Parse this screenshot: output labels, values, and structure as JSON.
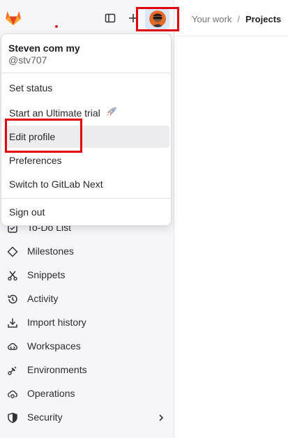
{
  "header": {
    "breadcrumb": {
      "parent": "Your work",
      "separator": "/",
      "current": "Projects"
    }
  },
  "user_menu": {
    "name": "Steven com my",
    "handle": "@stv707",
    "items": [
      {
        "label": "Set status"
      },
      {
        "label": "Start an Ultimate trial"
      },
      {
        "label": "Edit profile"
      },
      {
        "label": "Preferences"
      },
      {
        "label": "Switch to GitLab Next"
      },
      {
        "label": "Sign out"
      }
    ]
  },
  "sidebar": {
    "items": [
      {
        "label": "To-Do List",
        "icon": "todo-icon"
      },
      {
        "label": "Milestones",
        "icon": "milestone-icon"
      },
      {
        "label": "Snippets",
        "icon": "snippet-icon"
      },
      {
        "label": "Activity",
        "icon": "history-icon"
      },
      {
        "label": "Import history",
        "icon": "import-icon"
      },
      {
        "label": "Workspaces",
        "icon": "workspace-icon"
      },
      {
        "label": "Environments",
        "icon": "environment-icon"
      },
      {
        "label": "Operations",
        "icon": "cloud-gear-icon"
      },
      {
        "label": "Security",
        "icon": "shield-icon"
      }
    ]
  },
  "colors": {
    "highlight": "#e2000f",
    "sidebar_bg": "#f6f6f8",
    "hover_bg": "#ececef",
    "logo_orange": "#fc6d26"
  }
}
